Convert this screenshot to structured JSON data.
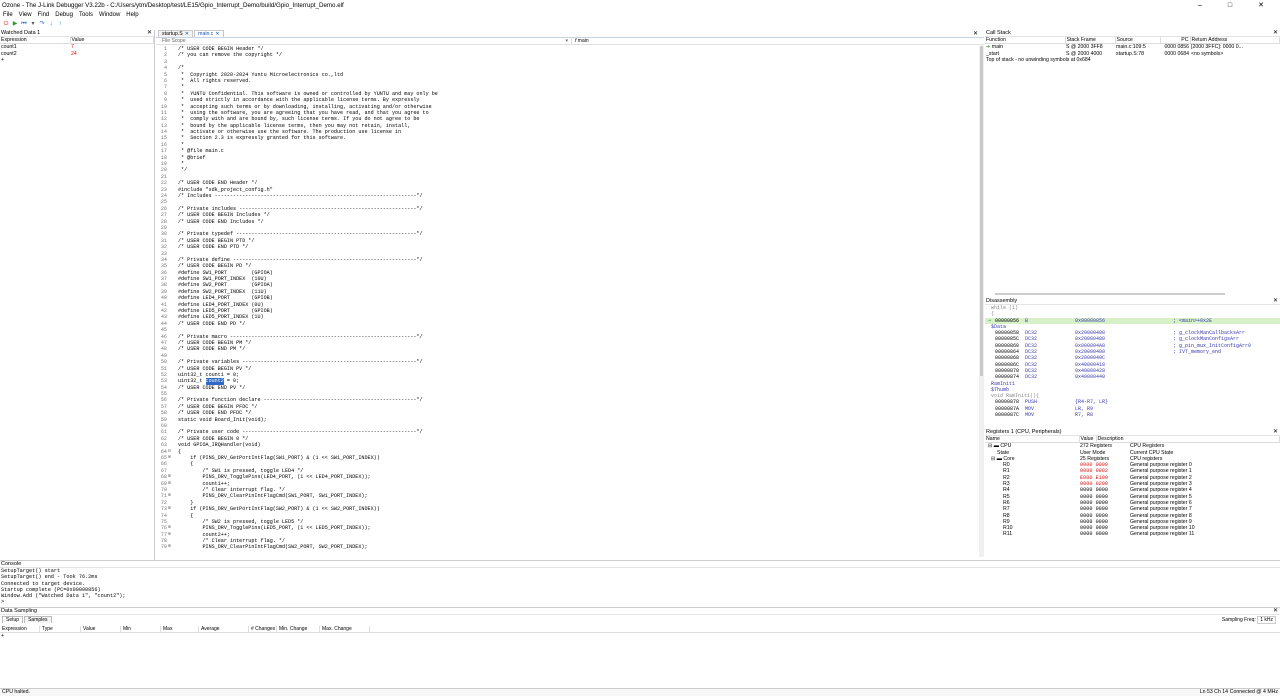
{
  "window": {
    "title": "Ozone - The J-Link Debugger V3.22b - C:/Users/ytm/Desktop/test/LE15/Gpio_Interrupt_Demo/build/Gpio_Interrupt_Demo.elf",
    "minimize": "–",
    "maximize": "□",
    "close": "✕"
  },
  "menu": [
    "File",
    "View",
    "Find",
    "Debug",
    "Tools",
    "Window",
    "Help"
  ],
  "watched": {
    "title": "Watched Data 1",
    "columns": [
      "Expression",
      "Value"
    ],
    "rows": [
      {
        "expr": "count1",
        "value": "7"
      },
      {
        "expr": "count2",
        "value": "24"
      }
    ],
    "new_row": "+"
  },
  "source": {
    "tabs": [
      {
        "label": "startup.S"
      },
      {
        "label": "main.c"
      }
    ],
    "file_scope": "File Scope",
    "function_scope": "main",
    "lines": [
      {
        "n": "1",
        "g": "",
        "c": "cmt",
        "t": "/* USER CODE BEGIN Header */"
      },
      {
        "n": "2",
        "g": "",
        "c": "cmt",
        "t": "/* you can remove the copyright */"
      },
      {
        "n": "3",
        "g": "",
        "c": "",
        "t": ""
      },
      {
        "n": "4",
        "g": "",
        "c": "cmt",
        "t": "/*"
      },
      {
        "n": "5",
        "g": "",
        "c": "cmt",
        "t": " *  Copyright 2020-2024 Yuntu Microelectronics co.,ltd"
      },
      {
        "n": "6",
        "g": "",
        "c": "cmt",
        "t": " *  All rights reserved."
      },
      {
        "n": "7",
        "g": "",
        "c": "cmt",
        "t": " *"
      },
      {
        "n": "8",
        "g": "",
        "c": "cmt",
        "t": " *  YUNTU Confidential. This software is owned or controlled by YUNTU and may only be"
      },
      {
        "n": "9",
        "g": "",
        "c": "cmt",
        "t": " *  used strictly in accordance with the applicable license terms. By expressly"
      },
      {
        "n": "10",
        "g": "",
        "c": "cmt",
        "t": " *  accepting such terms or by downloading, installing, activating and/or otherwise"
      },
      {
        "n": "11",
        "g": "",
        "c": "cmt",
        "t": " *  using the software, you are agreeing that you have read, and that you agree to"
      },
      {
        "n": "12",
        "g": "",
        "c": "cmt",
        "t": " *  comply with and are bound by, such license terms. If you do not agree to be"
      },
      {
        "n": "13",
        "g": "",
        "c": "cmt",
        "t": " *  bound by the applicable license terms, then you may not retain, install,"
      },
      {
        "n": "14",
        "g": "",
        "c": "cmt",
        "t": " *  activate or otherwise use the software. The production use license in"
      },
      {
        "n": "15",
        "g": "",
        "c": "cmt",
        "t": " *  Section 2.3 is expressly granted for this software."
      },
      {
        "n": "16",
        "g": "",
        "c": "cmt",
        "t": " *"
      },
      {
        "n": "17",
        "g": "",
        "c": "cmt",
        "t": " * @file main.c"
      },
      {
        "n": "18",
        "g": "",
        "c": "cmt",
        "t": " * @brief"
      },
      {
        "n": "19",
        "g": "",
        "c": "cmt",
        "t": " *"
      },
      {
        "n": "20",
        "g": "",
        "c": "cmt",
        "t": " */"
      },
      {
        "n": "21",
        "g": "",
        "c": "",
        "t": ""
      },
      {
        "n": "22",
        "g": "",
        "c": "cmt",
        "t": "/* USER CODE END Header */"
      },
      {
        "n": "23",
        "g": "",
        "c": "pp",
        "t": "#include \"sdk_project_config.h\""
      },
      {
        "n": "24",
        "g": "",
        "c": "cmt",
        "t": "/* Includes ------------------------------------------------------------------*/"
      },
      {
        "n": "25",
        "g": "",
        "c": "",
        "t": ""
      },
      {
        "n": "26",
        "g": "",
        "c": "cmt",
        "t": "/* Private includes ----------------------------------------------------------*/"
      },
      {
        "n": "27",
        "g": "",
        "c": "cmt",
        "t": "/* USER CODE BEGIN Includes */"
      },
      {
        "n": "28",
        "g": "",
        "c": "cmt",
        "t": "/* USER CODE END Includes */"
      },
      {
        "n": "29",
        "g": "",
        "c": "",
        "t": ""
      },
      {
        "n": "30",
        "g": "",
        "c": "cmt",
        "t": "/* Private typedef -----------------------------------------------------------*/"
      },
      {
        "n": "31",
        "g": "",
        "c": "cmt",
        "t": "/* USER CODE BEGIN PTD */"
      },
      {
        "n": "32",
        "g": "",
        "c": "cmt",
        "t": "/* USER CODE END PTD */"
      },
      {
        "n": "33",
        "g": "",
        "c": "",
        "t": ""
      },
      {
        "n": "34",
        "g": "",
        "c": "cmt",
        "t": "/* Private define ------------------------------------------------------------*/"
      },
      {
        "n": "35",
        "g": "",
        "c": "cmt",
        "t": "/* USER CODE BEGIN PD */"
      },
      {
        "n": "36",
        "g": "",
        "c": "pp",
        "t": "#define SW1_PORT        (GPIOA)"
      },
      {
        "n": "37",
        "g": "",
        "c": "pp",
        "t": "#define SW1_PORT_INDEX  (10U)"
      },
      {
        "n": "38",
        "g": "",
        "c": "pp",
        "t": "#define SW2_PORT        (GPIOA)"
      },
      {
        "n": "39",
        "g": "",
        "c": "pp",
        "t": "#define SW2_PORT_INDEX  (11U)"
      },
      {
        "n": "40",
        "g": "",
        "c": "pp",
        "t": "#define LED4_PORT       (GPIOB)"
      },
      {
        "n": "41",
        "g": "",
        "c": "pp",
        "t": "#define LED4_PORT_INDEX (0U)"
      },
      {
        "n": "42",
        "g": "",
        "c": "pp",
        "t": "#define LED5_PORT       (GPIOB)"
      },
      {
        "n": "43",
        "g": "",
        "c": "pp",
        "t": "#define LED5_PORT_INDEX (1U)"
      },
      {
        "n": "44",
        "g": "",
        "c": "cmt",
        "t": "/* USER CODE END PD */"
      },
      {
        "n": "45",
        "g": "",
        "c": "",
        "t": ""
      },
      {
        "n": "46",
        "g": "",
        "c": "cmt",
        "t": "/* Private macro -------------------------------------------------------------*/"
      },
      {
        "n": "47",
        "g": "",
        "c": "cmt",
        "t": "/* USER CODE BEGIN PM */"
      },
      {
        "n": "48",
        "g": "",
        "c": "cmt",
        "t": "/* USER CODE END PM */"
      },
      {
        "n": "49",
        "g": "",
        "c": "",
        "t": ""
      },
      {
        "n": "50",
        "g": "",
        "c": "cmt",
        "t": "/* Private variables ---------------------------------------------------------*/"
      },
      {
        "n": "51",
        "g": "",
        "c": "cmt",
        "t": "/* USER CODE BEGIN PV */"
      },
      {
        "n": "52",
        "g": "",
        "c": "",
        "t": "uint32_t count1 = 0;"
      },
      {
        "n": "53",
        "g": "",
        "c": "",
        "t": "uint32_t ",
        "hl": "count2",
        "rest": " = 0;"
      },
      {
        "n": "54",
        "g": "",
        "c": "cmt",
        "t": "/* USER CODE END PV */"
      },
      {
        "n": "55",
        "g": "",
        "c": "",
        "t": ""
      },
      {
        "n": "56",
        "g": "",
        "c": "cmt",
        "t": "/* Private function declare --------------------------------------------------*/"
      },
      {
        "n": "57",
        "g": "",
        "c": "cmt",
        "t": "/* USER CODE BEGIN PFDC */"
      },
      {
        "n": "58",
        "g": "",
        "c": "cmt",
        "t": "/* USER CODE END PFDC */"
      },
      {
        "n": "59",
        "g": "",
        "c": "kw",
        "t": "static void Board_Init(void);"
      },
      {
        "n": "60",
        "g": "",
        "c": "",
        "t": ""
      },
      {
        "n": "61",
        "g": "",
        "c": "cmt",
        "t": "/* Private user code ---------------------------------------------------------*/"
      },
      {
        "n": "62",
        "g": "",
        "c": "cmt",
        "t": "/* USER CODE BEGIN 0 */"
      },
      {
        "n": "63",
        "g": "",
        "c": "kw",
        "t": "void GPIOA_IRQHandler(void)"
      },
      {
        "n": "64",
        "g": "⊟",
        "c": "",
        "t": "{"
      },
      {
        "n": "65",
        "g": "⊞",
        "c": "",
        "t": "    if (PINS_DRV_GetPortIntFlag(SW1_PORT) & (1 << SW1_PORT_INDEX))"
      },
      {
        "n": "66",
        "g": "",
        "c": "",
        "t": "    {"
      },
      {
        "n": "67",
        "g": "",
        "c": "cmt",
        "t": "        /* SW1 is pressed, toggle LED4 */"
      },
      {
        "n": "68",
        "g": "⊞",
        "c": "",
        "t": "        PINS_DRV_TogglePins(LED4_PORT, (1 << LED4_PORT_INDEX));"
      },
      {
        "n": "69",
        "g": "⊞",
        "c": "",
        "t": "        count1++;"
      },
      {
        "n": "70",
        "g": "",
        "c": "cmt",
        "t": "        /* Clear interrupt flag. */"
      },
      {
        "n": "71",
        "g": "⊞",
        "c": "",
        "t": "        PINS_DRV_ClearPinIntFlagCmd(SW1_PORT, SW1_PORT_INDEX);"
      },
      {
        "n": "72",
        "g": "",
        "c": "",
        "t": "    }"
      },
      {
        "n": "73",
        "g": "⊞",
        "c": "",
        "t": "    if (PINS_DRV_GetPortIntFlag(SW2_PORT) & (1 << SW2_PORT_INDEX))"
      },
      {
        "n": "74",
        "g": "",
        "c": "",
        "t": "    {"
      },
      {
        "n": "75",
        "g": "",
        "c": "cmt",
        "t": "        /* SW2 is pressed, toggle LED5 */"
      },
      {
        "n": "76",
        "g": "⊞",
        "c": "",
        "t": "        PINS_DRV_TogglePins(LED5_PORT, (1 << LED5_PORT_INDEX));"
      },
      {
        "n": "77",
        "g": "⊞",
        "c": "",
        "t": "        count2++;"
      },
      {
        "n": "78",
        "g": "",
        "c": "cmt",
        "t": "        /* Clear interrupt flag. */"
      },
      {
        "n": "79",
        "g": "⊞",
        "c": "",
        "t": "        PINS_DRV_ClearPinIntFlagCmd(SW2_PORT, SW2_PORT_INDEX);"
      }
    ]
  },
  "callstack": {
    "title": "Call Stack",
    "columns": [
      "Function",
      "Stack Frame",
      "Source",
      "PC",
      "Return Address"
    ],
    "rows": [
      {
        "fn": "main",
        "frame": "S @ 2000 3FF8",
        "src": "main.c:109:5",
        "pc": "0000 0856",
        "ret": "[2000 3FFC]: 0000 0..."
      },
      {
        "fn": "_start",
        "frame": "S @ 2000 4000",
        "src": "startup.S:78",
        "pc": "0000 0684",
        "ret": "<no symbols>"
      }
    ],
    "note": "Top of stack - no unwinding symbols at 0x684"
  },
  "disasm": {
    "title": "Disassembly",
    "lines": [
      {
        "k": "src",
        "t": "while (1)"
      },
      {
        "k": "src",
        "t": "{"
      },
      {
        "k": "cur",
        "addr": "00000856",
        "op": "B",
        "arg": "0x00000856",
        "cm": "; <main>+0x2E"
      },
      {
        "k": "lab",
        "t": "$Data"
      },
      {
        "k": "row",
        "addr": "00000858",
        "op": "DC32",
        "arg": "0x20000408",
        "cm": "; g_clockManCallbacksArr"
      },
      {
        "k": "row",
        "addr": "0000085C",
        "op": "DC32",
        "arg": "0x20000480",
        "cm": "; g_clockManConfigsArr"
      },
      {
        "k": "row",
        "addr": "00000860",
        "op": "DC32",
        "arg": "0x000004A8",
        "cm": "; g_pin_mux_InitConfigArr0"
      },
      {
        "k": "row",
        "addr": "00000864",
        "op": "DC32",
        "arg": "0x20000400",
        "cm": "; IVT_memory_end"
      },
      {
        "k": "row",
        "addr": "00000868",
        "op": "DC32",
        "arg": "0x2000040C",
        "cm": ""
      },
      {
        "k": "row",
        "addr": "0000086C",
        "op": "DC32",
        "arg": "0x40000418",
        "cm": ""
      },
      {
        "k": "row",
        "addr": "00000870",
        "op": "DC32",
        "arg": "0x40000428",
        "cm": ""
      },
      {
        "k": "row",
        "addr": "00000874",
        "op": "DC32",
        "arg": "0x40000440",
        "cm": ""
      },
      {
        "k": "lab",
        "t": "RamInit1"
      },
      {
        "k": "lab",
        "t": "$Thumb"
      },
      {
        "k": "src",
        "t": "void RamInit1(){"
      },
      {
        "k": "row",
        "addr": "00000878",
        "op": "PUSH",
        "arg": "{R4-R7, LR}",
        "cm": ""
      },
      {
        "k": "row",
        "addr": "0000087A",
        "op": "MOV",
        "arg": "LR, R9",
        "cm": ""
      },
      {
        "k": "row",
        "addr": "0000087C",
        "op": "MOV",
        "arg": "R7, R8",
        "cm": ""
      }
    ]
  },
  "registers": {
    "title": "Registers 1 (CPU, Peripherals)",
    "columns": [
      "Name",
      "Value",
      "Description"
    ],
    "groups": [
      {
        "name": "CPU",
        "value": "272 Registers",
        "desc": "CPU Registers"
      },
      {
        "name": "State",
        "value": "User Mode",
        "desc": "Current CPU State"
      },
      {
        "name": "Core",
        "value": "25 Registers",
        "desc": "CPU registers"
      }
    ],
    "rows": [
      {
        "name": "R0",
        "value": "0000 0009",
        "desc": "General purpose register 0",
        "red": true
      },
      {
        "name": "R1",
        "value": "0000 0002",
        "desc": "General purpose register 1",
        "red": true
      },
      {
        "name": "R2",
        "value": "E000 E100",
        "desc": "General purpose register 2",
        "red": true
      },
      {
        "name": "R3",
        "value": "0000 0200",
        "desc": "General purpose register 3",
        "red": true
      },
      {
        "name": "R4",
        "value": "0000 0000",
        "desc": "General purpose register 4",
        "red": false
      },
      {
        "name": "R5",
        "value": "0000 0000",
        "desc": "General purpose register 5",
        "red": false
      },
      {
        "name": "R6",
        "value": "0000 0000",
        "desc": "General purpose register 6",
        "red": false
      },
      {
        "name": "R7",
        "value": "0000 0000",
        "desc": "General purpose register 7",
        "red": false
      },
      {
        "name": "R8",
        "value": "0000 0000",
        "desc": "General purpose register 8",
        "red": false
      },
      {
        "name": "R9",
        "value": "0000 0000",
        "desc": "General purpose register 9",
        "red": false
      },
      {
        "name": "R10",
        "value": "0000 0000",
        "desc": "General purpose register 10",
        "red": false
      },
      {
        "name": "R11",
        "value": "0000 0000",
        "desc": "General purpose register 11",
        "red": false
      }
    ]
  },
  "console": {
    "title": "Console",
    "lines": [
      "SetupTarget() start",
      "SetupTarget() end - Took 76.2ms",
      "Connected to target device.",
      "Startup complete (PC=0x00000856)",
      "Window.Add (\"Watched Data 1\", \"count2\");"
    ],
    "prompt": ">"
  },
  "sampling": {
    "title": "Data Sampling",
    "tabs": [
      "Setup",
      "Samples"
    ],
    "freq_label": "Sampling Freq:",
    "freq_value": "1 kHz",
    "columns": [
      "Expression",
      "Type",
      "Value",
      "Min",
      "Max",
      "Average",
      "# Changes",
      "Min. Change",
      "Max. Change"
    ],
    "new_row": "+"
  },
  "status": {
    "left": "CPU halted.",
    "position": "Ln 53  Ch 14",
    "connection": "Connected @ 4 MHz"
  },
  "colors": {
    "comment": "#2e8b1e",
    "preprocessor": "#4a4ab8",
    "selection": "#3169c6",
    "changed_register": "#d11111"
  }
}
